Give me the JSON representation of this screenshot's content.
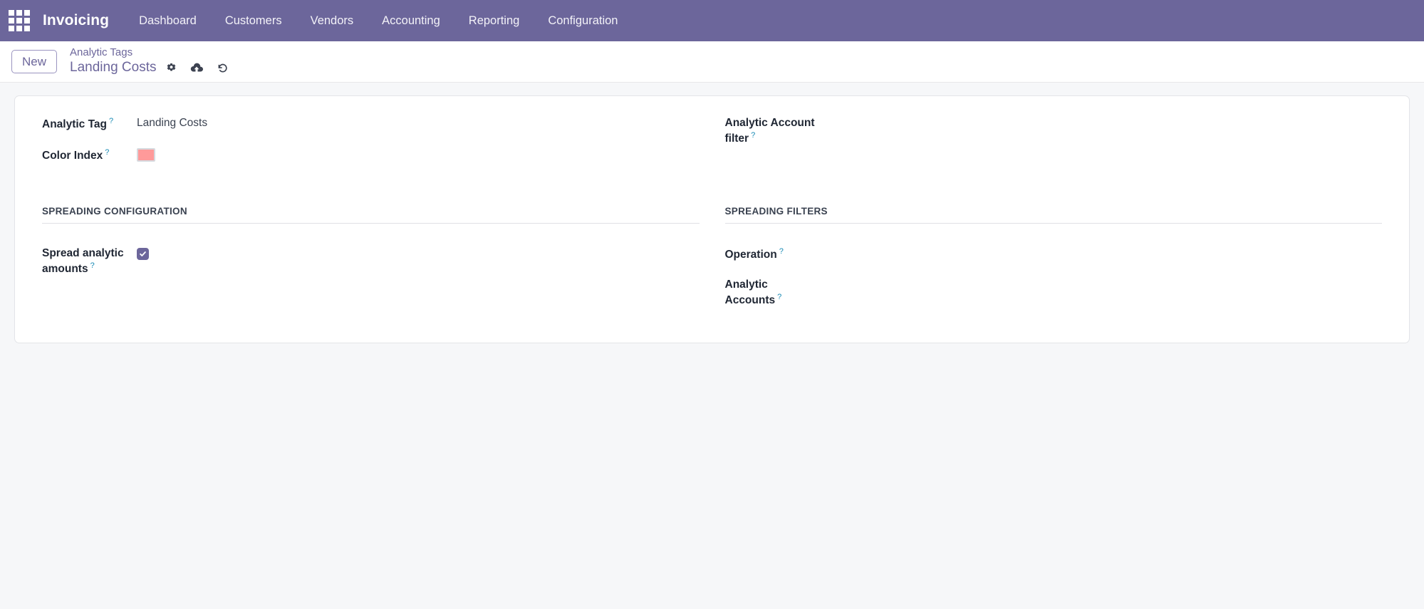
{
  "navbar": {
    "apps_icon": "apps-grid-icon",
    "brand": "Invoicing",
    "items": [
      {
        "label": "Dashboard"
      },
      {
        "label": "Customers"
      },
      {
        "label": "Vendors"
      },
      {
        "label": "Accounting"
      },
      {
        "label": "Reporting"
      },
      {
        "label": "Configuration"
      }
    ],
    "background_color": "#6C669B"
  },
  "control_panel": {
    "new_button": "New",
    "breadcrumb_parent": "Analytic Tags",
    "breadcrumb_current": "Landing Costs",
    "icons": [
      {
        "name": "gear-icon",
        "title": "Settings"
      },
      {
        "name": "cloud-upload-icon",
        "title": "Save manually"
      },
      {
        "name": "undo-icon",
        "title": "Discard changes"
      }
    ]
  },
  "form": {
    "left": {
      "fields": [
        {
          "label": "Analytic Tag",
          "help": "?",
          "value": "Landing Costs"
        },
        {
          "label": "Color Index",
          "help": "?",
          "color": "#FF9A9A"
        }
      ],
      "section_title": "SPREADING CONFIGURATION",
      "spread_label": "Spread analytic amounts",
      "spread_help": "?",
      "spread_checked": true
    },
    "right": {
      "fields": [
        {
          "label": "Analytic Account filter",
          "help": "?",
          "value": ""
        }
      ],
      "section_title": "SPREADING FILTERS",
      "operation_label": "Operation",
      "operation_help": "?",
      "operation_value": "",
      "accounts_label": "Analytic Accounts",
      "accounts_help": "?",
      "accounts_value": ""
    }
  },
  "theme": {
    "primary": "#6C669B",
    "page_background": "#F6F7F9",
    "sheet_background": "#FFFFFF",
    "help_color": "#1A8BB5"
  }
}
